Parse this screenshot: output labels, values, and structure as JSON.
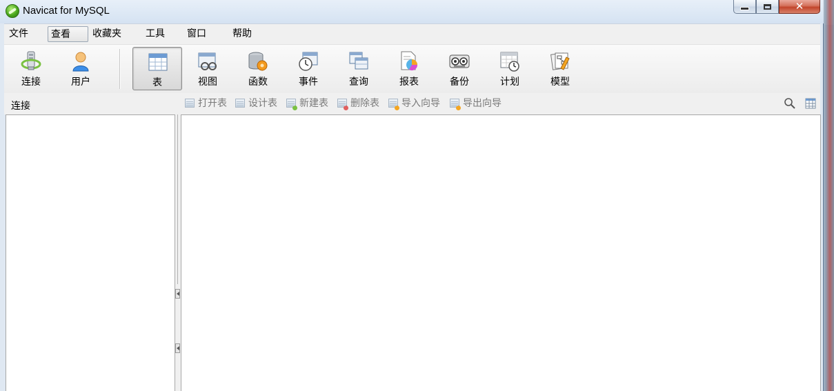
{
  "window": {
    "title": "Navicat for MySQL",
    "controls": {
      "minimize": "minimize",
      "maximize": "maximize",
      "close": "close"
    }
  },
  "menubar": {
    "items": [
      {
        "label": "文件"
      },
      {
        "label": "查看",
        "active": true
      },
      {
        "label": "收藏夹"
      },
      {
        "label": "工具"
      },
      {
        "label": "窗口"
      },
      {
        "label": "帮助"
      }
    ]
  },
  "toolbar": {
    "items": [
      {
        "label": "连接",
        "icon": "connection-icon"
      },
      {
        "label": "用户",
        "icon": "user-icon"
      },
      {
        "label": "表",
        "icon": "table-icon",
        "active": true
      },
      {
        "label": "视图",
        "icon": "view-icon"
      },
      {
        "label": "函数",
        "icon": "function-icon"
      },
      {
        "label": "事件",
        "icon": "event-icon"
      },
      {
        "label": "查询",
        "icon": "query-icon"
      },
      {
        "label": "报表",
        "icon": "report-icon"
      },
      {
        "label": "备份",
        "icon": "backup-icon"
      },
      {
        "label": "计划",
        "icon": "schedule-icon"
      },
      {
        "label": "模型",
        "icon": "model-icon"
      }
    ]
  },
  "objectbar": {
    "connection_label": "连接",
    "buttons": [
      {
        "label": "打开表",
        "enabled": false
      },
      {
        "label": "设计表",
        "enabled": false
      },
      {
        "label": "新建表",
        "enabled": false
      },
      {
        "label": "删除表",
        "enabled": false
      },
      {
        "label": "导入向导",
        "enabled": false
      },
      {
        "label": "导出向导",
        "enabled": false
      }
    ]
  },
  "colors": {
    "accent_close": "#c2452b",
    "disabled_text": "#7a7a7a",
    "pane_background": "#ffffff"
  }
}
